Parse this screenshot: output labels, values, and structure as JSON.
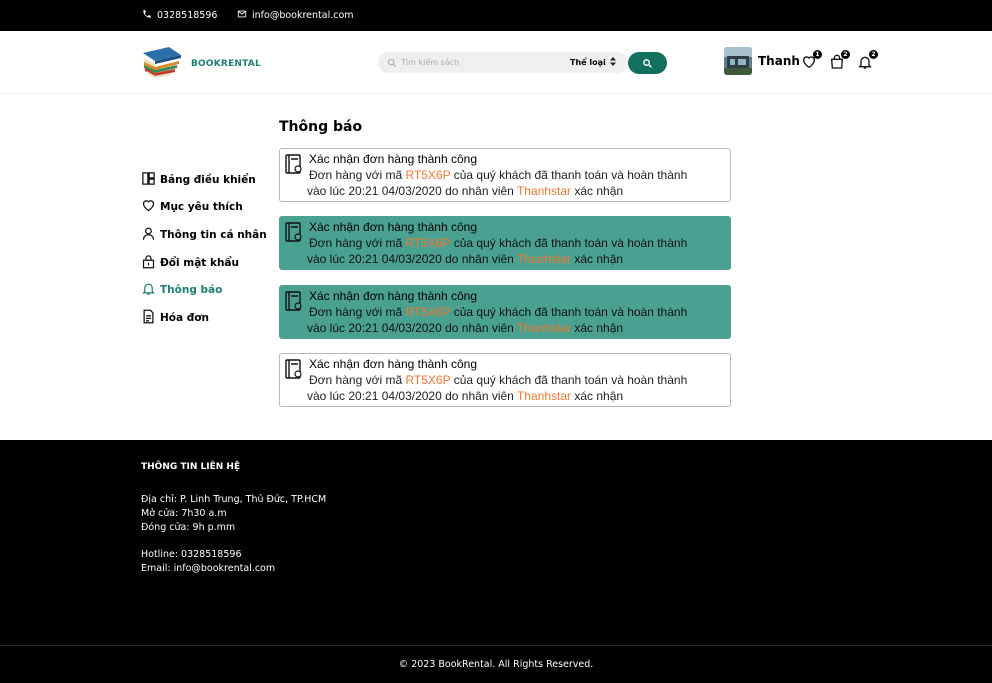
{
  "topbar": {
    "phone": "0328518596",
    "email": "info@bookrental.com"
  },
  "header": {
    "logo_text": "BOOKRENTAL",
    "search_placeholder": "Tìm kiếm sách",
    "category_label": "Thể loại",
    "user_name": "Thanh",
    "wishlist_count": "1",
    "cart_count": "2",
    "notification_count": "2"
  },
  "sidebar": {
    "items": [
      {
        "label": "Bảng điều khiển",
        "icon": "dashboard-icon"
      },
      {
        "label": "Mục yêu thích",
        "icon": "heart-icon"
      },
      {
        "label": "Thông tin cá nhân",
        "icon": "user-icon"
      },
      {
        "label": "Đổi mật khẩu",
        "icon": "lock-icon"
      },
      {
        "label": "Thông báo",
        "icon": "bell-icon",
        "active": true
      },
      {
        "label": "Hóa đơn",
        "icon": "invoice-icon"
      }
    ]
  },
  "main": {
    "title": "Thông báo",
    "notifications": [
      {
        "title": "Xác nhận đơn hàng thành công",
        "prefix": "Đơn hàng với mã",
        "code": "RT5X6P",
        "mid": "của quý khách đã thanh toán và hoàn thành",
        "line2": "vào lúc 20:21 04/03/2020 do nhân viên",
        "staff": "Thanhstar",
        "suffix": "xác nhận",
        "read": false
      },
      {
        "title": "Xác nhận đơn hàng thành công",
        "prefix": "Đơn hàng với mã",
        "code": "RT5X6P",
        "mid": "của quý khách đã thanh toán và hoàn thành",
        "line2": "vào lúc 20:21 04/03/2020 do nhân viên",
        "staff": "Thanhstar",
        "suffix": "xác nhận",
        "read": true
      },
      {
        "title": "Xác nhận đơn hàng thành công",
        "prefix": "Đơn hàng với mã",
        "code": "RT5X6P",
        "mid": "của quý khách đã thanh toán và hoàn thành",
        "line2": "vào lúc 20:21 04/03/2020 do nhân viên",
        "staff": "Thanhstar",
        "suffix": "xác nhận",
        "read": true
      },
      {
        "title": "Xác nhận đơn hàng thành công",
        "prefix": "Đơn hàng với mã",
        "code": "RT5X6P",
        "mid": "của quý khách đã thanh toán và hoàn thành",
        "line2": "vào lúc 20:21 04/03/2020 do nhân viên",
        "staff": "Thanhstar",
        "suffix": "xác nhận",
        "read": false
      }
    ]
  },
  "footer": {
    "heading": "THÔNG TIN LIÊN HỆ",
    "address": "Địa chỉ: P. Linh Trung, Thủ Đức, TP.HCM",
    "open": "Mở cửa: 7h30 a.m",
    "close": "Đóng cửa: 9h p.mm",
    "hotline": "Hotline: 0328518596",
    "email": "Email: info@bookrental.com",
    "copyright": "© 2023 BookRental. All Rights Reserved."
  },
  "colors": {
    "accent": "#1e8070",
    "read_bg": "#4aa192",
    "highlight": "#f2762e",
    "button": "#12705f"
  }
}
